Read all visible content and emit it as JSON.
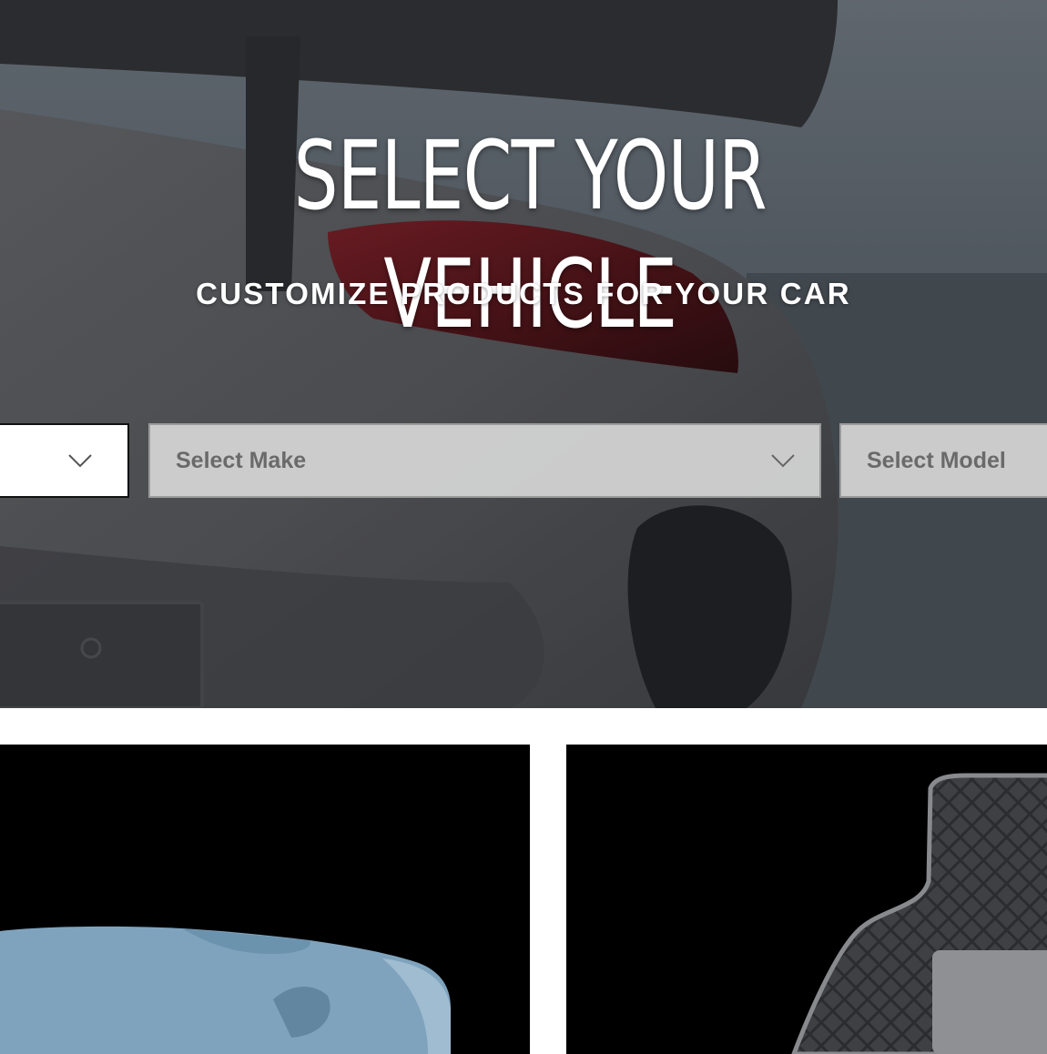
{
  "hero": {
    "title": "SELECT YOUR VEHICLE",
    "subtitle": "CUSTOMIZE PRODUCTS FOR YOUR CAR",
    "selectors": {
      "year": {
        "value": ""
      },
      "make": {
        "placeholder": "Select Make"
      },
      "model": {
        "placeholder": "Select Model"
      }
    }
  },
  "tiles": {
    "left": {
      "image": "car-cover-image"
    },
    "right": {
      "image": "floor-mat-image"
    }
  },
  "icons": {
    "dropdown": "chevron-down-icon"
  },
  "colors": {
    "title": "#ffffff",
    "tile_bg": "#000000",
    "car_cover": "#7fa3bd",
    "select_text": "#6a6a6a"
  }
}
